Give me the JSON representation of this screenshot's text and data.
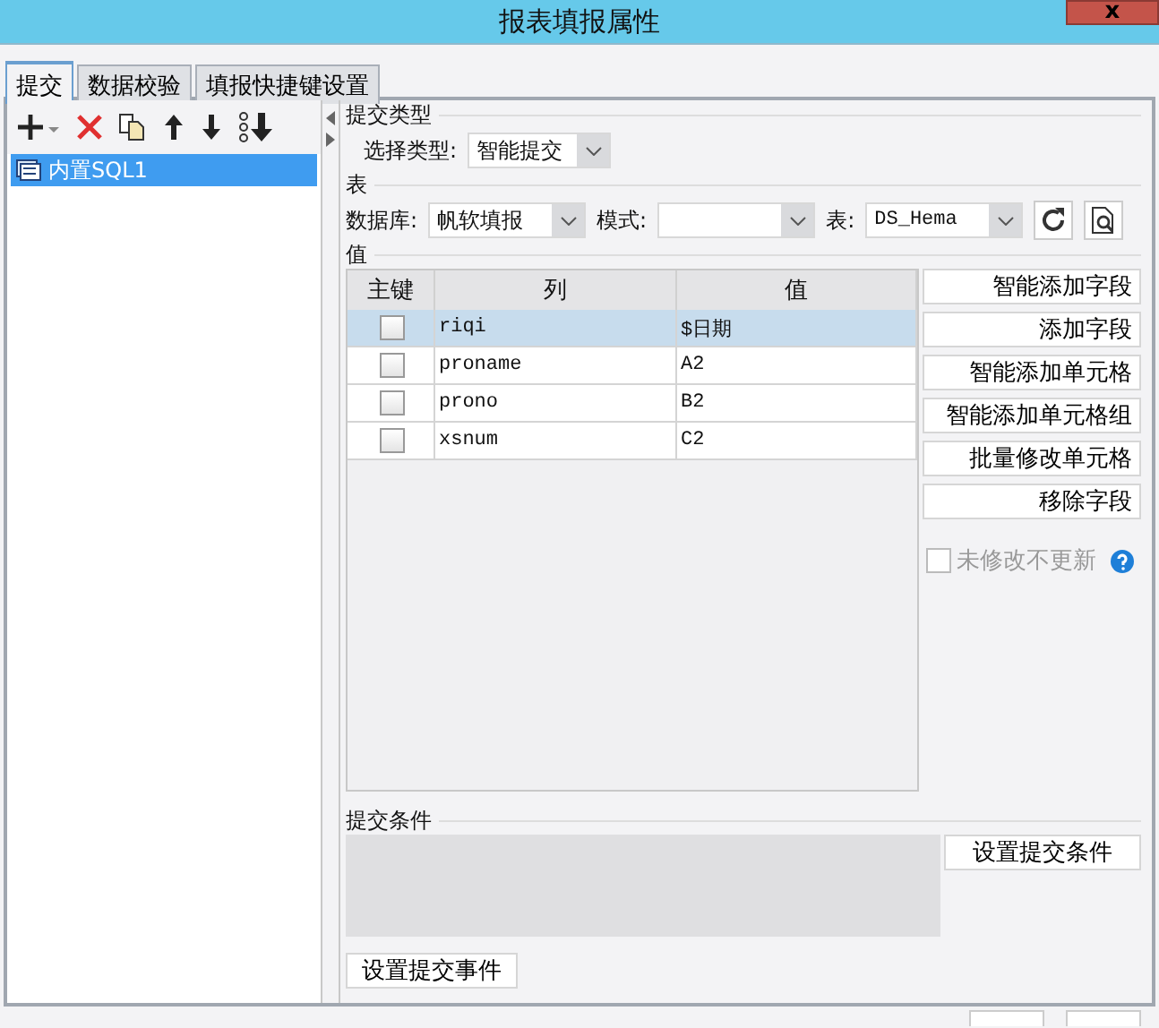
{
  "window": {
    "title": "报表填报属性",
    "close": "x"
  },
  "tabs": [
    {
      "label": "提交",
      "selected": true
    },
    {
      "label": "数据校验",
      "selected": false
    },
    {
      "label": "填报快捷键设置",
      "selected": false
    }
  ],
  "list": {
    "items": [
      {
        "label": "内置SQL1",
        "selected": true
      }
    ]
  },
  "submit_type": {
    "heading": "提交类型",
    "label": "选择类型:",
    "value": "智能提交"
  },
  "table_section": {
    "heading": "表",
    "database_label": "数据库:",
    "database": "帆软填报",
    "schema_label": "模式:",
    "table_label": "表:",
    "table": "DS_Hema"
  },
  "values": {
    "heading": "值",
    "columns": [
      "主键",
      "列",
      "值"
    ],
    "rows": [
      {
        "key": false,
        "column": "riqi",
        "value": "$日期",
        "selected": true
      },
      {
        "key": false,
        "column": "proname",
        "value": "A2",
        "selected": false
      },
      {
        "key": false,
        "column": "prono",
        "value": "B2",
        "selected": false
      },
      {
        "key": false,
        "column": "xsnum",
        "value": "C2",
        "selected": false
      }
    ],
    "buttons": [
      "智能添加字段",
      "添加字段",
      "智能添加单元格",
      "智能添加单元格组",
      "批量修改单元格",
      "移除字段"
    ],
    "no_update": {
      "label": "未修改不更新",
      "checked": false,
      "disabled": true
    }
  },
  "condition": {
    "heading": "提交条件",
    "button": "设置提交条件"
  },
  "event_button": "设置提交事件"
}
